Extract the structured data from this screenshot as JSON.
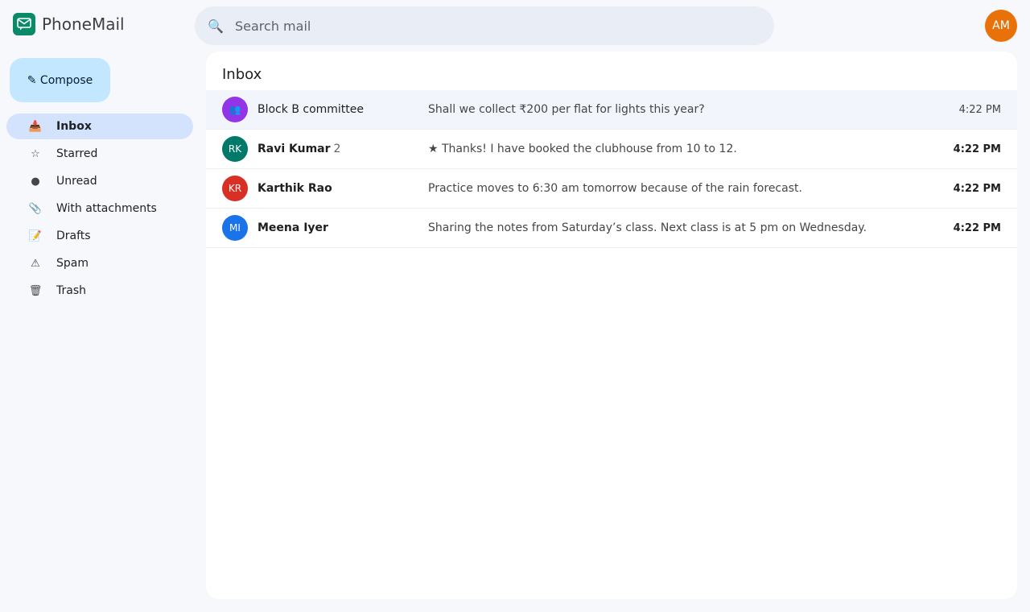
{
  "app": {
    "name": "PhoneMail"
  },
  "search": {
    "placeholder": "Search mail",
    "icon": "search-icon"
  },
  "account": {
    "initials": "AM",
    "color": "#e8710a"
  },
  "compose": {
    "label": "✎ Compose"
  },
  "nav": {
    "items": [
      {
        "label": "Inbox",
        "icon": "📥",
        "active": true
      },
      {
        "label": "Starred",
        "icon": "☆"
      },
      {
        "label": "Unread",
        "icon": "●"
      },
      {
        "label": "With attachments",
        "icon": "📎"
      },
      {
        "label": "Drafts",
        "icon": "📝"
      },
      {
        "label": "Spam",
        "icon": "⚠"
      },
      {
        "label": "Trash",
        "icon": "🗑"
      }
    ]
  },
  "inbox": {
    "title": "Inbox",
    "threads": [
      {
        "avatar": "👥",
        "avatar_color": "#9334e6",
        "sender": "Block B committee",
        "count": "",
        "subject": "Shall we collect ₹200 per flat for lights this year?",
        "time": "4:22 PM",
        "unread": false,
        "selected": true
      },
      {
        "avatar": "RK",
        "avatar_color": "#00796b",
        "sender": "Ravi Kumar",
        "count": "2",
        "subject": "★ Thanks! I have booked the clubhouse from 10 to 12.",
        "time": "4:22 PM",
        "unread": true
      },
      {
        "avatar": "KR",
        "avatar_color": "#d93025",
        "sender": "Karthik Rao",
        "count": "",
        "subject": "Practice moves to 6:30 am tomorrow because of the rain forecast.",
        "time": "4:22 PM",
        "unread": true
      },
      {
        "avatar": "MI",
        "avatar_color": "#1a73e8",
        "sender": "Meena Iyer",
        "count": "",
        "subject": "Sharing the notes from Saturday’s class. Next class is at 5 pm on Wednesday.",
        "time": "4:22 PM",
        "unread": true
      }
    ]
  }
}
